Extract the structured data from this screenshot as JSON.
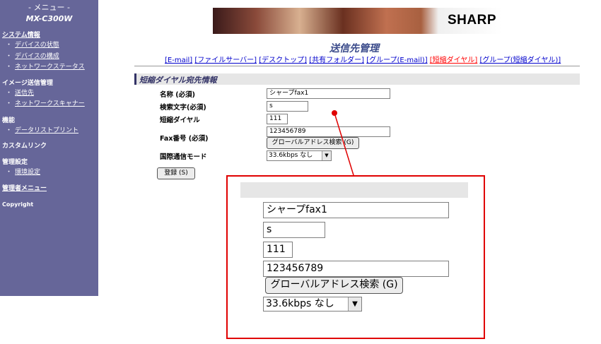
{
  "sidebar": {
    "menu_label": "- メニュー -",
    "model": "MX-C300W",
    "system_info": "システム情報",
    "device_status": "デバイスの状態",
    "device_config": "デバイスの構成",
    "network_status": "ネットワークステータス",
    "image_send": "イメージ送信管理",
    "destination": "送信先",
    "network_scanner": "ネットワークスキャナー",
    "functions": "機能",
    "data_list_print": "データリストプリント",
    "custom_link": "カスタムリンク",
    "admin_settings": "管理設定",
    "env_settings": "環境設定",
    "admin_menu": "管理者メニュー",
    "copyright": "Copyright",
    "bullet": "・"
  },
  "banner": {
    "logo": "SHARP"
  },
  "page": {
    "title": "送信先管理",
    "tabs": [
      {
        "label": "[E-mail]"
      },
      {
        "label": "[ファイルサーバー]"
      },
      {
        "label": "[デスクトップ]"
      },
      {
        "label": "[共有フォルダー]"
      },
      {
        "label": "[グループ(E-mail)]"
      },
      {
        "label": "[短縮ダイヤル]"
      },
      {
        "label": "[グループ(短縮ダイヤル)]"
      }
    ]
  },
  "form": {
    "section_title": "短縮ダイヤル宛先情報",
    "name_label": "名称 (必須)",
    "name_value": "シャープfax1",
    "search_label": "検索文字(必須)",
    "search_value": "s",
    "speed_dial_label": "短縮ダイヤル",
    "speed_dial_value": "111",
    "fax_label": "Fax番号 (必須)",
    "fax_value": "123456789",
    "global_search_button": "グローバルアドレス検索 (G)",
    "intl_mode_label": "国際通信モード",
    "intl_mode_value": "33.6kbps なし",
    "register_button": "登録 (S)"
  },
  "colors": {
    "sidebar_bg": "#666699",
    "link": "#0000cc",
    "active_tab": "#ff0000",
    "callout": "#e00000",
    "title": "#3a4a8a"
  }
}
